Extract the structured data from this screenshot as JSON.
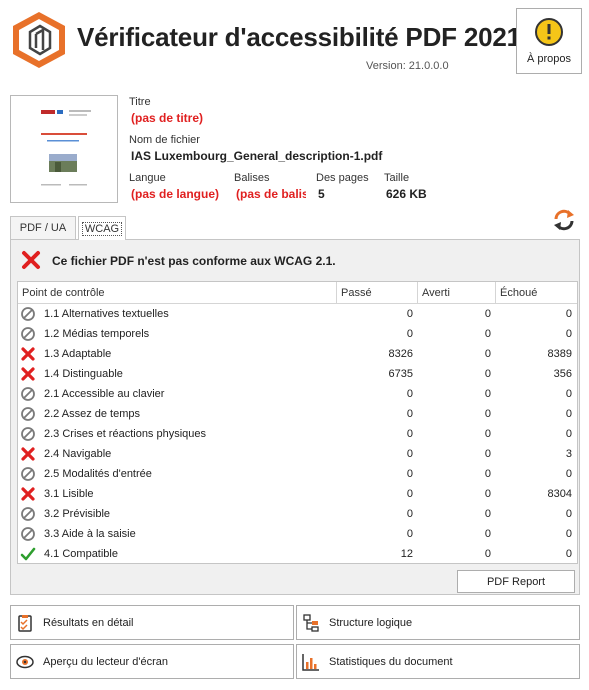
{
  "header": {
    "title": "Vérificateur d'accessibilité PDF 2021",
    "version": "Version: 21.0.0.0",
    "about_label": "À propos",
    "brand_color": "#e8712a"
  },
  "file_info": {
    "title_label": "Titre",
    "title_value": "(pas de titre)",
    "filename_label": "Nom de fichier",
    "filename_value": "IAS Luxembourg_General_description-1.pdf",
    "language_label": "Langue",
    "language_value": "(pas de langue)",
    "tags_label": "Balises",
    "tags_value": "(pas de balis",
    "pages_label": "Des pages",
    "pages_value": "5",
    "size_label": "Taille",
    "size_value": "626 KB"
  },
  "tabs": [
    {
      "label": "PDF / UA",
      "active": false
    },
    {
      "label": "WCAG",
      "active": true
    }
  ],
  "verdict": {
    "text": "Ce fichier PDF n'est pas conforme aux WCAG 2.1.",
    "status": "fail-icon"
  },
  "table": {
    "columns": [
      "Point de contrôle",
      "Passé",
      "Averti",
      "Échoué"
    ],
    "rows": [
      {
        "icon": "na-icon",
        "name": "1.1 Alternatives textuelles",
        "passed": "0",
        "warned": "0",
        "failed": "0"
      },
      {
        "icon": "na-icon",
        "name": "1.2 Médias temporels",
        "passed": "0",
        "warned": "0",
        "failed": "0"
      },
      {
        "icon": "fail-icon",
        "name": "1.3 Adaptable",
        "passed": "8326",
        "warned": "0",
        "failed": "8389"
      },
      {
        "icon": "fail-icon",
        "name": "1.4 Distinguable",
        "passed": "6735",
        "warned": "0",
        "failed": "356"
      },
      {
        "icon": "na-icon",
        "name": "2.1 Accessible au clavier",
        "passed": "0",
        "warned": "0",
        "failed": "0"
      },
      {
        "icon": "na-icon",
        "name": "2.2 Assez de temps",
        "passed": "0",
        "warned": "0",
        "failed": "0"
      },
      {
        "icon": "na-icon",
        "name": "2.3 Crises et réactions physiques",
        "passed": "0",
        "warned": "0",
        "failed": "0"
      },
      {
        "icon": "fail-icon",
        "name": "2.4 Navigable",
        "passed": "0",
        "warned": "0",
        "failed": "3"
      },
      {
        "icon": "na-icon",
        "name": "2.5 Modalités d'entrée",
        "passed": "0",
        "warned": "0",
        "failed": "0"
      },
      {
        "icon": "fail-icon",
        "name": "3.1 Lisible",
        "passed": "0",
        "warned": "0",
        "failed": "8304"
      },
      {
        "icon": "na-icon",
        "name": "3.2 Prévisible",
        "passed": "0",
        "warned": "0",
        "failed": "0"
      },
      {
        "icon": "na-icon",
        "name": "3.3 Aide à la saisie",
        "passed": "0",
        "warned": "0",
        "failed": "0"
      },
      {
        "icon": "pass-icon",
        "name": "4.1 Compatible",
        "passed": "12",
        "warned": "0",
        "failed": "0"
      }
    ]
  },
  "pdf_report_label": "PDF Report",
  "bottom_buttons": {
    "details": "Résultats en détail",
    "structure": "Structure logique",
    "screen_reader": "Aperçu du lecteur d'écran",
    "statistics": "Statistiques du document"
  },
  "colors": {
    "fail": "#e02020",
    "pass": "#2e9e2e",
    "na": "#7a7a7a",
    "accent": "#e8712a"
  }
}
